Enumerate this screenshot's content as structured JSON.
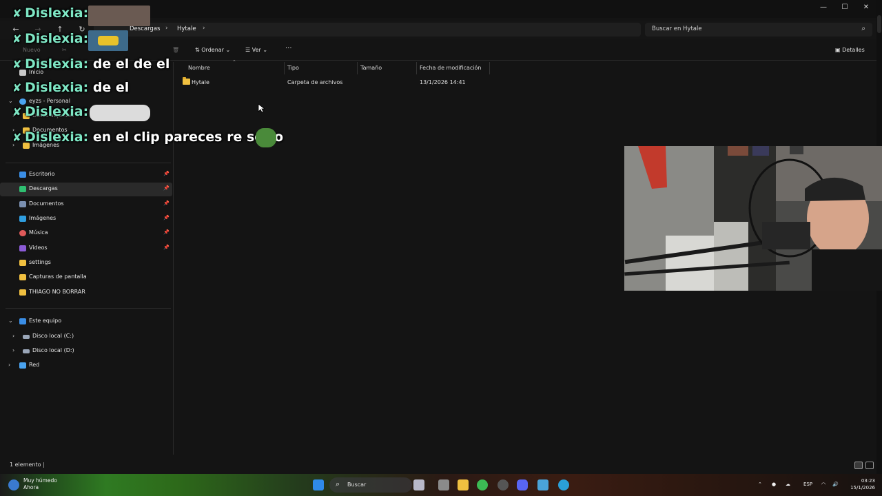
{
  "titlebar": {
    "minimize": "—",
    "maximize": "☐",
    "close": "✕"
  },
  "addressbar": {
    "crumbs": [
      "Descargas",
      "Hytale"
    ],
    "sep": "›"
  },
  "search": {
    "placeholder": "Buscar en Hytale",
    "icon": "search-icon"
  },
  "toolbar": {
    "new_label": "Nuevo",
    "sort_label": "Ordenar",
    "view_label": "Ver",
    "more": "···",
    "details_label": "Detalles"
  },
  "sidebar": {
    "top": [
      {
        "label": "Inicio",
        "icon": "home-icon"
      },
      {
        "label": "eyzs - Personal",
        "icon": "cloud-icon"
      },
      {
        "label": "Datos adjuntos",
        "icon": "folder-icon"
      },
      {
        "label": "Documentos",
        "icon": "folder-icon"
      },
      {
        "label": "Imágenes",
        "icon": "folder-icon"
      }
    ],
    "quick": [
      {
        "label": "Escritorio",
        "icon": "desktop-icon",
        "color": "#3a8ee6"
      },
      {
        "label": "Descargas",
        "icon": "download-icon",
        "color": "#2fbf71"
      },
      {
        "label": "Documentos",
        "icon": "document-icon",
        "color": "#7a8fb0"
      },
      {
        "label": "Imágenes",
        "icon": "pictures-icon",
        "color": "#2f9ee0"
      },
      {
        "label": "Música",
        "icon": "music-icon",
        "color": "#e05a5a"
      },
      {
        "label": "Videos",
        "icon": "video-icon",
        "color": "#8b5bd6"
      },
      {
        "label": "settings",
        "icon": "folder-icon",
        "color": "#f0c040"
      },
      {
        "label": "Capturas de pantalla",
        "icon": "folder-icon",
        "color": "#f0c040"
      },
      {
        "label": "THIAGO NO BORRAR",
        "icon": "folder-icon",
        "color": "#f0c040"
      }
    ],
    "this_pc": {
      "label": "Este equipo",
      "icon": "computer-icon"
    },
    "drives": [
      {
        "label": "Disco local (C:)",
        "icon": "drive-icon"
      },
      {
        "label": "Disco local (D:)",
        "icon": "drive-icon"
      }
    ],
    "network": {
      "label": "Red",
      "icon": "network-icon"
    }
  },
  "columns": [
    "Nombre",
    "Tipo",
    "Tamaño",
    "Fecha de modificación"
  ],
  "files": [
    {
      "name": "Hytale",
      "type": "Carpeta de archivos",
      "size": "",
      "modified": "13/1/2026 14:41"
    }
  ],
  "status": {
    "count": "1 elemento"
  },
  "chat": [
    {
      "user": "Dislexia:",
      "message": ""
    },
    {
      "user": "Dislexia:",
      "message": ""
    },
    {
      "user": "Dislexia:",
      "message": "de el de el"
    },
    {
      "user": "Dislexia:",
      "message": "de el"
    },
    {
      "user": "Dislexia:",
      "message": ""
    },
    {
      "user": "Dislexia:",
      "message": "en el clip pareces re serio"
    }
  ],
  "taskbar": {
    "weather_line1": "Muy húmedo",
    "weather_line2": "Ahora",
    "search_label": "Buscar",
    "lang": "ESP",
    "time": "03:23",
    "date": "15/1/2026"
  },
  "colors": {
    "accent": "#7ee6c4",
    "folder": "#f0c040",
    "window_bg": "#141414"
  }
}
